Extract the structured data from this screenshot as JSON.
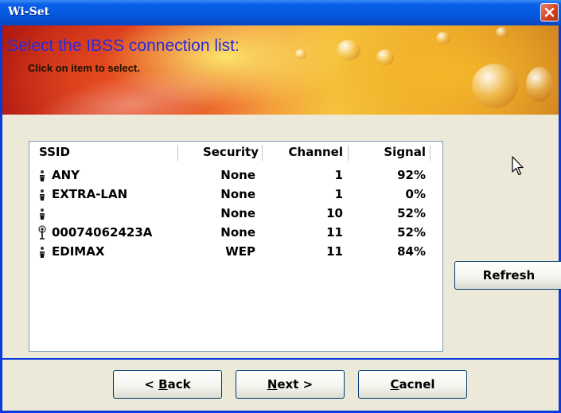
{
  "window": {
    "title": "Wi-Set",
    "close_icon": "close-icon"
  },
  "banner": {
    "title": "Select the IBSS connection list:",
    "subtitle": "Click on item to select."
  },
  "list": {
    "columns": [
      "SSID",
      "Security",
      "Channel",
      "Signal"
    ],
    "rows": [
      {
        "ssid": "ANY",
        "security": "None",
        "channel": "1",
        "signal": "92%",
        "icon": "ibss-station-icon"
      },
      {
        "ssid": "EXTRA-LAN",
        "security": "None",
        "channel": "1",
        "signal": "0%",
        "icon": "ibss-station-icon"
      },
      {
        "ssid": "",
        "security": "None",
        "channel": "10",
        "signal": "52%",
        "icon": "ibss-station-icon"
      },
      {
        "ssid": "00074062423A",
        "security": "None",
        "channel": "11",
        "signal": "52%",
        "icon": "access-point-icon"
      },
      {
        "ssid": "EDIMAX",
        "security": "WEP",
        "channel": "11",
        "signal": "84%",
        "icon": "ibss-station-icon"
      }
    ]
  },
  "buttons": {
    "refresh": "Refresh",
    "back_prefix": "< ",
    "back_accel": "B",
    "back_rest": "ack",
    "next_accel": "N",
    "next_rest": "ext >",
    "cancel_accel": "C",
    "cancel_rest": "acnel"
  },
  "colors": {
    "titlebar": "#0456dc",
    "banner_title": "#2a2adc",
    "frame": "#0a3bd8"
  }
}
